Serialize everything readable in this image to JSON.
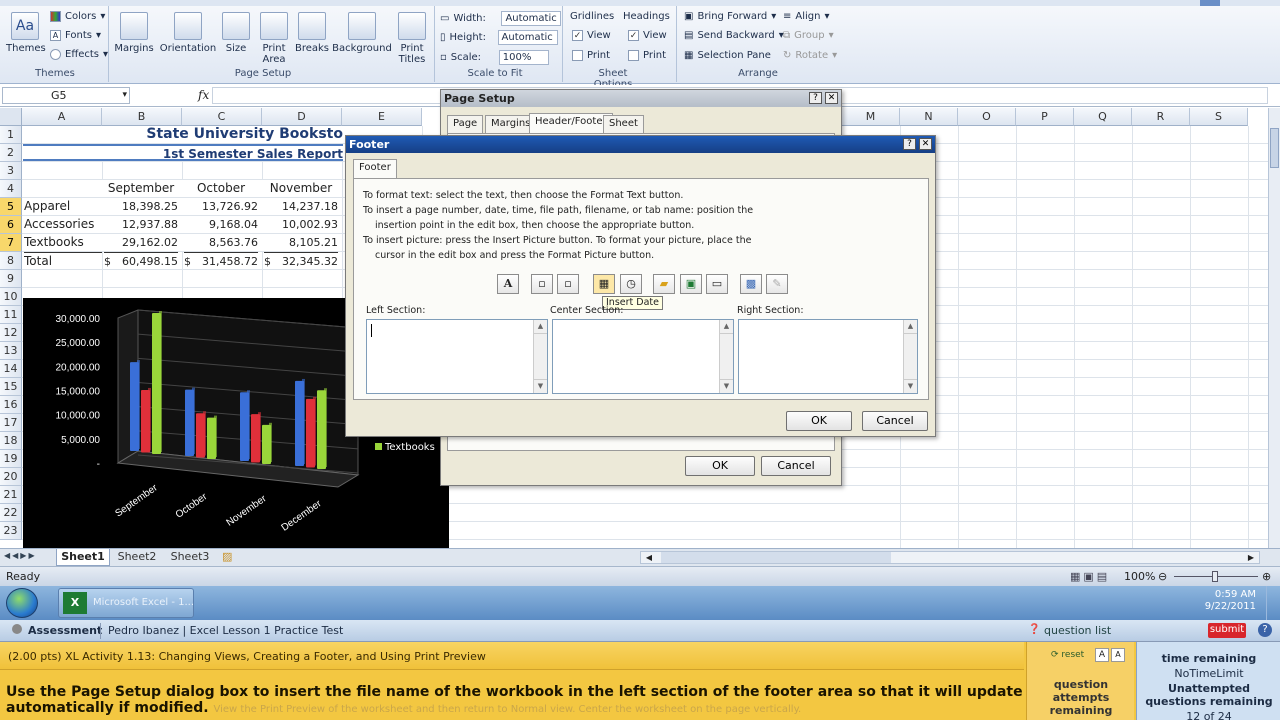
{
  "ribbon": {
    "themes": {
      "label": "Themes",
      "colors": "Colors",
      "fonts": "Fonts",
      "effects": "Effects",
      "group": "Themes"
    },
    "page_setup": {
      "margins": "Margins",
      "orientation": "Orientation",
      "size": "Size",
      "print_area": "Print Area",
      "breaks": "Breaks",
      "background": "Background",
      "print_titles": "Print Titles",
      "group": "Page Setup"
    },
    "scale": {
      "width_label": "Width:",
      "width_value": "Automatic",
      "height_label": "Height:",
      "height_value": "Automatic",
      "scale_label": "Scale:",
      "scale_value": "100%",
      "group": "Scale to Fit"
    },
    "sheet_options": {
      "gridlines": "Gridlines",
      "headings": "Headings",
      "view": "View",
      "print": "Print",
      "group": "Sheet Options"
    },
    "arrange": {
      "bring_forward": "Bring Forward",
      "send_backward": "Send Backward",
      "selection_pane": "Selection Pane",
      "align": "Align",
      "group_btn": "Group",
      "rotate": "Rotate",
      "group": "Arrange"
    }
  },
  "formula_bar": {
    "name_box": "G5",
    "fx": "fx"
  },
  "columns": [
    "A",
    "B",
    "C",
    "D",
    "E",
    "M",
    "N",
    "O",
    "P",
    "Q",
    "R",
    "S"
  ],
  "rows": [
    "1",
    "2",
    "3",
    "4",
    "5",
    "6",
    "7",
    "8",
    "9",
    "10",
    "11",
    "12",
    "13",
    "14",
    "15",
    "16",
    "17",
    "18",
    "19",
    "20",
    "21",
    "22",
    "23"
  ],
  "sheet": {
    "title": "State University Booksto",
    "subtitle": "1st Semester Sales Report",
    "months": [
      "September",
      "October",
      "November"
    ],
    "data": [
      {
        "label": "Apparel",
        "v": [
          "18,398.25",
          "13,726.92",
          "14,237.18"
        ]
      },
      {
        "label": "Accessories",
        "v": [
          "12,937.88",
          "9,168.04",
          "10,002.93"
        ]
      },
      {
        "label": "Textbooks",
        "v": [
          "29,162.02",
          "8,563.76",
          "8,105.21"
        ]
      }
    ],
    "total": {
      "label": "Total",
      "cur": "$",
      "v": [
        "60,498.15",
        "31,458.72",
        "32,345.32"
      ]
    }
  },
  "chart_data": {
    "type": "bar",
    "categories": [
      "September",
      "October",
      "November",
      "December"
    ],
    "y_ticks": [
      "30,000.00",
      "25,000.00",
      "20,000.00",
      "15,000.00",
      "10,000.00",
      "5,000.00",
      "-"
    ],
    "ylim": [
      0,
      30000
    ],
    "series": [
      {
        "name": "",
        "color": "#3a6fd8",
        "values": [
          18398,
          13727,
          14237,
          17600
        ]
      },
      {
        "name": "",
        "color": "#e0303a",
        "values": [
          12938,
          9168,
          10003,
          14200
        ]
      },
      {
        "name": "Textbooks",
        "color": "#9ad63a",
        "values": [
          29162,
          8564,
          8105,
          16300
        ]
      }
    ],
    "legend_label": "Textbooks"
  },
  "page_setup_dialog": {
    "title": "Page Setup",
    "tabs": [
      "Page",
      "Margins",
      "Header/Footer",
      "Sheet"
    ],
    "ok": "OK",
    "cancel": "Cancel"
  },
  "footer_dialog": {
    "title": "Footer",
    "tab": "Footer",
    "instructions": [
      "To format text:  select the text, then choose the Format Text button.",
      "To insert a page number, date, time, file path, filename, or tab name:  position the",
      "insertion point in the edit box, then choose the appropriate button.",
      "To insert picture:  press the Insert Picture button.  To format your picture, place the",
      "cursor in the edit box and press the Format Picture button."
    ],
    "tooltip": "Insert Date",
    "left": "Left Section:",
    "center": "Center Section:",
    "right": "Right Section:",
    "ok": "OK",
    "cancel": "Cancel"
  },
  "sheet_tabs": [
    "Sheet1",
    "Sheet2",
    "Sheet3"
  ],
  "status": {
    "ready": "Ready",
    "zoom": "100%"
  },
  "taskbar": {
    "app": "Microsoft Excel - 1...",
    "time": "0:59 AM",
    "date": "9/22/2011"
  },
  "assessment": {
    "label": "Assessment",
    "user": "Pedro Ibanez | Excel Lesson 1 Practice Test",
    "question_list": "question list",
    "submit": "submit",
    "reset": "reset",
    "header": "(2.00 pts) XL Activity 1.13: Changing Views, Creating a Footer, and Using Print Preview",
    "instruction": "Use the Page Setup dialog box to insert the file name of the workbook in the left section of the footer area so that it will update automatically if modified.",
    "instruction_faded": "View the Print Preview of the worksheet and then return to Normal view. Center the worksheet on the page vertically.",
    "attempts": "question attempts remaining",
    "time_label": "time remaining",
    "time_value": "NoTimeLimit",
    "unattempted": "Unattempted questions remaining",
    "count": "12 of 24"
  }
}
